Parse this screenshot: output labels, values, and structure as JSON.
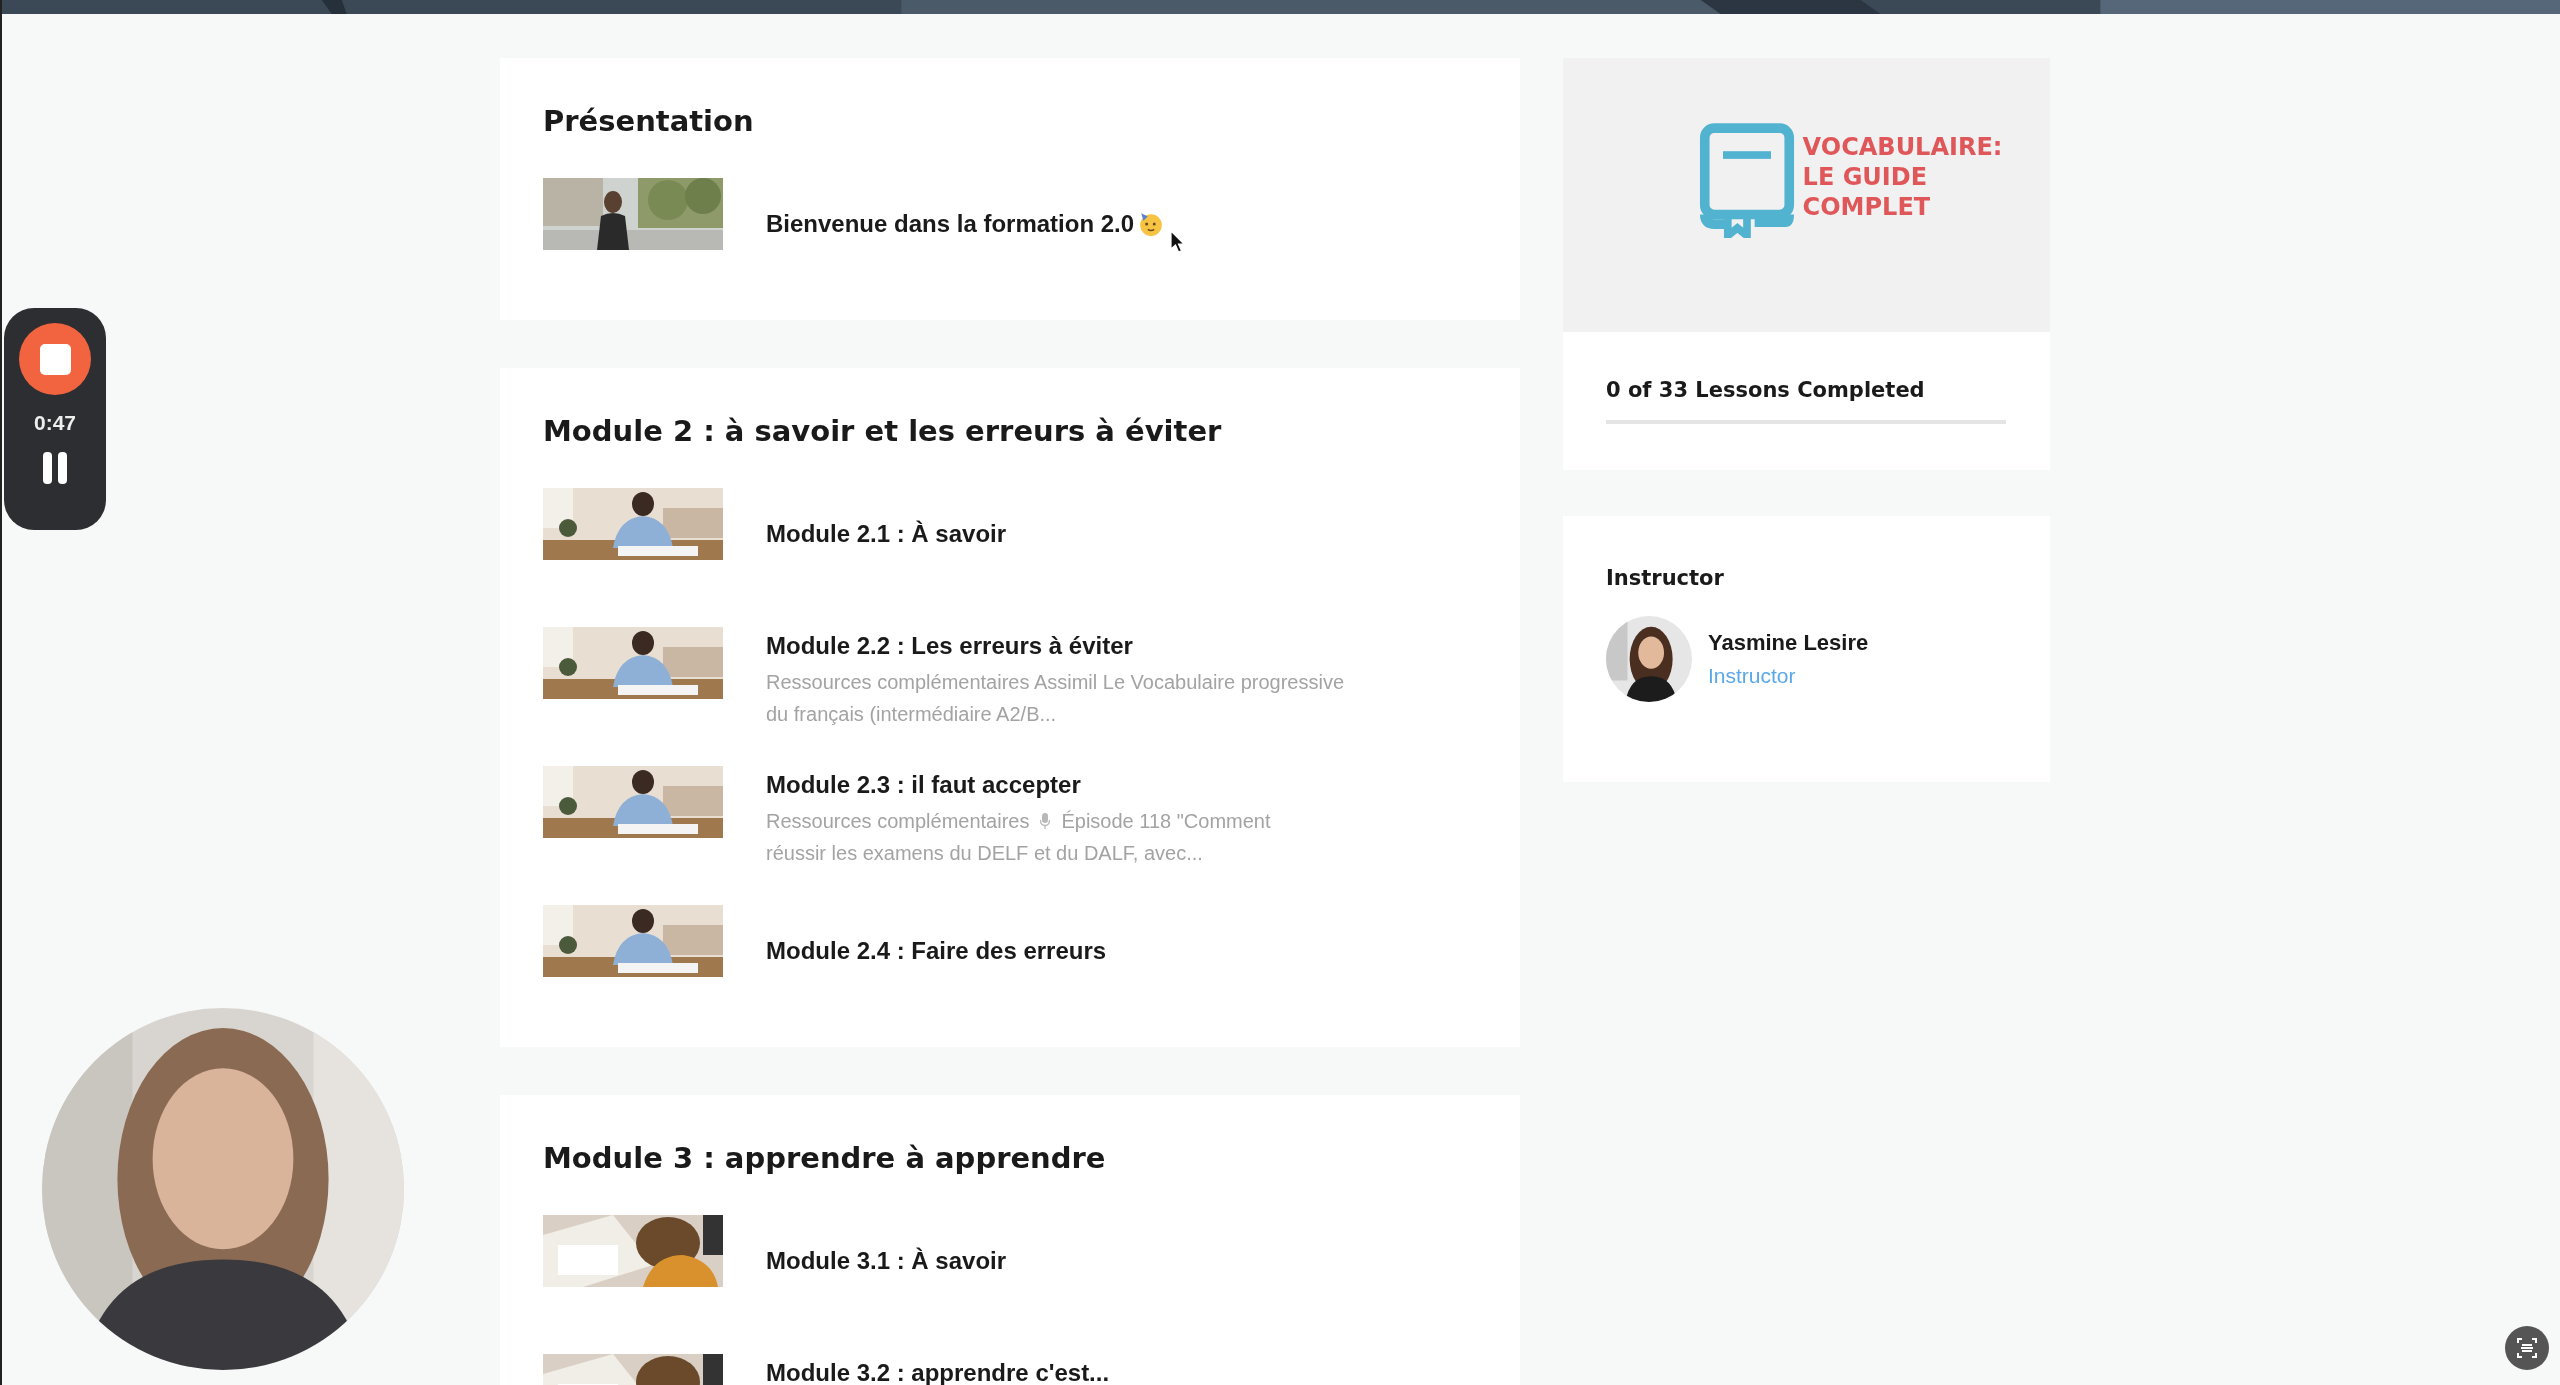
{
  "recorder": {
    "timer": "0:47"
  },
  "sections": [
    {
      "title": "Présentation",
      "items": [
        {
          "title": "Bienvenue dans la formation 2.0",
          "has_emoji": true
        }
      ]
    },
    {
      "title": "Module 2 : à savoir et les erreurs à éviter",
      "items": [
        {
          "title": "Module 2.1 : À savoir"
        },
        {
          "title": "Module 2.2 : Les erreurs à éviter",
          "excerpt": " Ressources complémentaires  Assimil  Le Vocabulaire progressive du français (intermédiaire A2/B..."
        },
        {
          "title": "Module 2.3 : il faut accepter",
          "excerpt_lines": [
            [
              "Ressources complémentaires",
              "Épisode 118 \"Comment"
            ],
            [
              "réussir les examens du DELF et du DALF, avec..."
            ]
          ]
        },
        {
          "title": "Module 2.4 : Faire des erreurs"
        }
      ]
    },
    {
      "title": "Module 3 : apprendre à apprendre",
      "items": [
        {
          "title": "Module 3.1 : À savoir"
        },
        {
          "title": "Module 3.2 : apprendre c'est..."
        }
      ]
    }
  ],
  "course": {
    "logo_lines": [
      "VOCABULAIRE:",
      "LE GUIDE",
      "COMPLET"
    ]
  },
  "progress": {
    "label": "0 of 33 Lessons Completed",
    "level": 0
  },
  "instructor": {
    "heading": "Instructor",
    "name": "Yasmine Lesire",
    "role": "Instructor"
  }
}
